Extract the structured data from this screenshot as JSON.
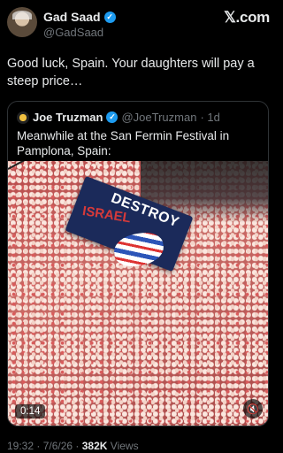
{
  "author": {
    "name": "Gad Saad",
    "handle": "@GadSaad",
    "verified_icon": "verified-badge-icon"
  },
  "brand": "𝕏.com",
  "tweet": {
    "text": "Good luck, Spain. Your daughters will pay a steep price…"
  },
  "quoted_tweet": {
    "name": "Joe Truzman",
    "handle": "@JoeTruzman",
    "age": "· 1d",
    "text": "Meanwhile at the San Fermin Festival in Pamplona, Spain:",
    "media": {
      "banner_top": "DESTROY",
      "banner_mid": "ISRAEL",
      "duration": "0:14",
      "mute_icon": "muted-speaker-icon"
    }
  },
  "footer": {
    "time": "19:32",
    "date": "7/6/26",
    "views_count": "382K",
    "views_label": "Views"
  },
  "colors": {
    "background": "#000000",
    "text": "#e7e9ea",
    "secondary": "#71767b",
    "verified": "#1d9bf0",
    "border": "#2f3336"
  }
}
